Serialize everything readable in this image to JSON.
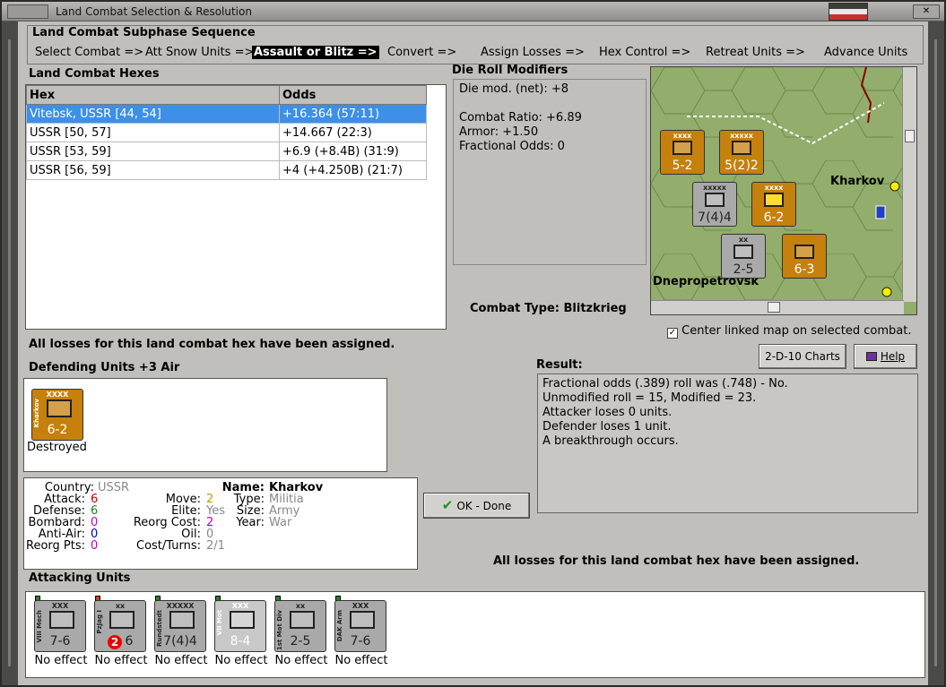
{
  "window": {
    "title": "Land Combat Selection & Resolution"
  },
  "sequence": {
    "title": "Land Combat Subphase Sequence",
    "steps": [
      "Select Combat =>",
      "Att Snow Units =>",
      "Assault or Blitz =>",
      "Convert =>",
      "Assign Losses =>",
      "Hex Control =>",
      "Retreat Units =>",
      "Advance Units"
    ],
    "active_index": 2
  },
  "hexes": {
    "title": "Land Combat Hexes",
    "columns": [
      "Hex",
      "Odds"
    ],
    "rows": [
      {
        "hex": "Vitebsk, USSR [44, 54]",
        "odds": "+16.364 (57:11)",
        "selected": true
      },
      {
        "hex": "USSR [50, 57]",
        "odds": "+14.667 (22:3)",
        "selected": false
      },
      {
        "hex": "USSR [53, 59]",
        "odds": "+6.9 (+8.4B) (31:9)",
        "selected": false
      },
      {
        "hex": "USSR [56, 59]",
        "odds": "+4 (+4.250B) (21:7)",
        "selected": false
      }
    ]
  },
  "die_roll": {
    "title": "Die Roll Modifiers",
    "lines": [
      "Die mod. (net): +8",
      "",
      "Combat Ratio: +6.89",
      "Armor: +1.50",
      "Fractional Odds: 0"
    ]
  },
  "combat_type": {
    "label": "Combat Type:",
    "value": "Blitzkrieg"
  },
  "map": {
    "city_labels": [
      "Kharkov",
      "Dnepropetrovsk"
    ],
    "counters": [
      {
        "size": "xxxx",
        "val": "5-2",
        "color": "orange"
      },
      {
        "size": "xxxxx",
        "val": "5(2)2",
        "color": "orange"
      },
      {
        "size": "xxxxx",
        "val": "7(4)4",
        "color": "gray"
      },
      {
        "size": "xxxx",
        "val": "6-2",
        "color": "orange"
      },
      {
        "size": "xx",
        "val": "2-5",
        "color": "gray"
      },
      {
        "size": "",
        "val": "6-3",
        "color": "orange"
      }
    ]
  },
  "center_map": {
    "checked": true,
    "label": "Center linked map on selected combat."
  },
  "losses_assigned": "All losses for this land combat hex have been assigned.",
  "defending": {
    "title": "Defending Units +3 Air",
    "units": [
      {
        "name": "Kharkov",
        "size": "XXXX",
        "val": "6-2",
        "status": "Destroyed"
      }
    ]
  },
  "buttons": {
    "charts": "2-D-10 Charts",
    "help": "Help",
    "ok": "OK - Done"
  },
  "result": {
    "title": "Result:",
    "lines": [
      "Fractional odds (.389) roll was (.748)  - No.",
      "Unmodified roll = 15, Modified = 23.",
      "Attacker loses 0 units.",
      "Defender loses 1 unit.",
      "A breakthrough occurs."
    ]
  },
  "unit_details": {
    "country": "USSR",
    "attack": "6",
    "defense": "6",
    "bombard": "0",
    "anti_air": "0",
    "reorg_pts": "0",
    "move": "2",
    "elite": "Yes",
    "reorg_cost": "2",
    "oil": "0",
    "cost_turns": "2/1",
    "name": "Kharkov",
    "type": "Militia",
    "size": "Army",
    "year": "War"
  },
  "bottom_losses": "All losses for this land combat hex have been assigned.",
  "attacking": {
    "title": "Attacking Units",
    "units": [
      {
        "name": "VIII Mech",
        "size": "XXX",
        "val": "7-6",
        "status": "No effect"
      },
      {
        "name": "PzJag I",
        "size": "xx",
        "val": "6",
        "status": "No effect"
      },
      {
        "name": "Rundstedt",
        "size": "XXXXX",
        "val": "7(4)4",
        "status": "No effect"
      },
      {
        "name": "VII Mot",
        "size": "XXX",
        "val": "8-4",
        "status": "No effect"
      },
      {
        "name": "1st Mot Div",
        "size": "xx",
        "val": "2-5",
        "status": "No effect"
      },
      {
        "name": "DAK Arm",
        "size": "XXX",
        "val": "7-6",
        "status": "No effect"
      }
    ]
  }
}
